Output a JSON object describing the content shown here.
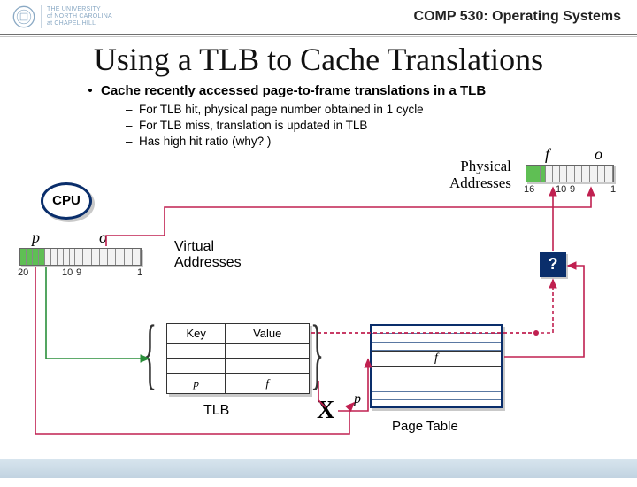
{
  "header": {
    "univ_line1": "THE UNIVERSITY",
    "univ_line2": "of NORTH CAROLINA",
    "univ_line3": "at CHAPEL HILL",
    "course": "COMP 530: Operating Systems"
  },
  "title": "Using a TLB to Cache Translations",
  "bullet_main": "Cache recently accessed page-to-frame translations in a TLB",
  "sub_bullets": [
    "For TLB hit, physical page number obtained in 1 cycle",
    "For TLB miss, translation is updated in TLB",
    "Has high hit ratio (why? )"
  ],
  "cpu_label": "CPU",
  "va": {
    "p": "p",
    "o": "o",
    "label": "Virtual\nAddresses",
    "tick_20": "20",
    "tick_10": "10",
    "tick_9": "9",
    "tick_1": "1"
  },
  "pa": {
    "f": "f",
    "o": "o",
    "label": "Physical\nAddresses",
    "tick_16": "16",
    "tick_10": "10",
    "tick_9": "9",
    "tick_1": "1"
  },
  "tlb": {
    "key": "Key",
    "value": "Value",
    "p": "p",
    "f": "f",
    "label": "TLB"
  },
  "page_table": {
    "f": "f",
    "label": "Page Table",
    "p_in": "p"
  },
  "qmark": "?",
  "xmark": "X"
}
